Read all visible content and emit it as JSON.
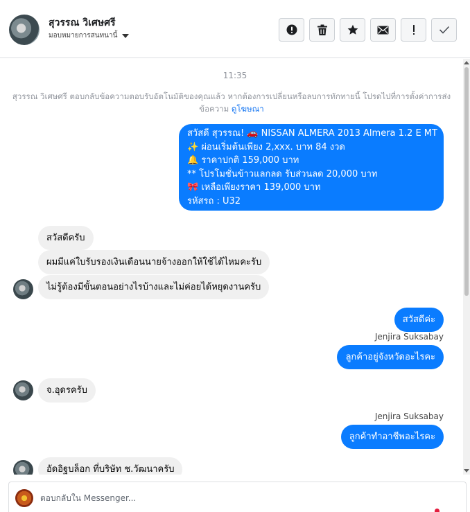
{
  "header": {
    "name": "สุวรรณ วิเศษศรี",
    "subtitle": "มอบหมายการสนทนานี้",
    "actions": [
      {
        "id": "spam",
        "icon": "alert-circle-icon"
      },
      {
        "id": "delete",
        "icon": "trash-icon"
      },
      {
        "id": "star",
        "icon": "star-icon"
      },
      {
        "id": "unread",
        "icon": "envelope-icon"
      },
      {
        "id": "follow-up",
        "icon": "exclamation-icon"
      },
      {
        "id": "done",
        "icon": "check-icon"
      }
    ]
  },
  "thread": {
    "time": "11:35",
    "notice_text": "สุวรรณ วิเศษศรี ตอบกลับข้อความตอบรับอัตโนมัติของคุณแล้ว หากต้องการเปลี่ยนหรือลบการทักทายนี้ โปรดไปที่การตั้งค่าการส่งข้อความ",
    "notice_link": "ดูโฆษณา",
    "promo_lines": [
      "สวัสดี สุวรรณ! 🚗  NISSAN ALMERA 2013 Almera 1.2 E MT",
      "✨  ผ่อนเริ่มต้นเพียง 2,xxx. บาท 84 งวด",
      "🔔 ราคาปกติ 159,000 บาท",
      "** โปรโมชั่นข้าวแลกลด รับส่วนลด 20,000 บาท",
      "🎀  เหลือเพียงราคา 139,000 บาท",
      " รหัสรถ : U32"
    ],
    "messages": {
      "in1": "สวัสดีครับ",
      "in2": "ผมมีแค่ใบรับรองเงินเดือนนายจ้างออกให้ใช้ได้ไหมคะรับ",
      "in3": "ไม่รู้ต้องมีขั้นตอนอย่างไรบ้างและไม่ค่อยได้หยุดงานครับ",
      "out1": "สวัสดีค่ะ",
      "sender1": "Jenjira Suksabay",
      "out2": "ลูกค้าอยู่จังหวัดอะไรคะ",
      "in4": "จ.อุดรครับ",
      "sender2": "Jenjira Suksabay",
      "out3": "ลูกค้าทำอาชีพอะไรคะ",
      "in5": "อัดอิฐบล็อก ที่บริษัท ช.วัฒนาครับ"
    }
  },
  "composer": {
    "placeholder": "ตอบกลับใน Messenger..."
  },
  "colors": {
    "outgoing": "#0a7cff",
    "incoming": "#f0f0f0",
    "link": "#1877f2"
  }
}
